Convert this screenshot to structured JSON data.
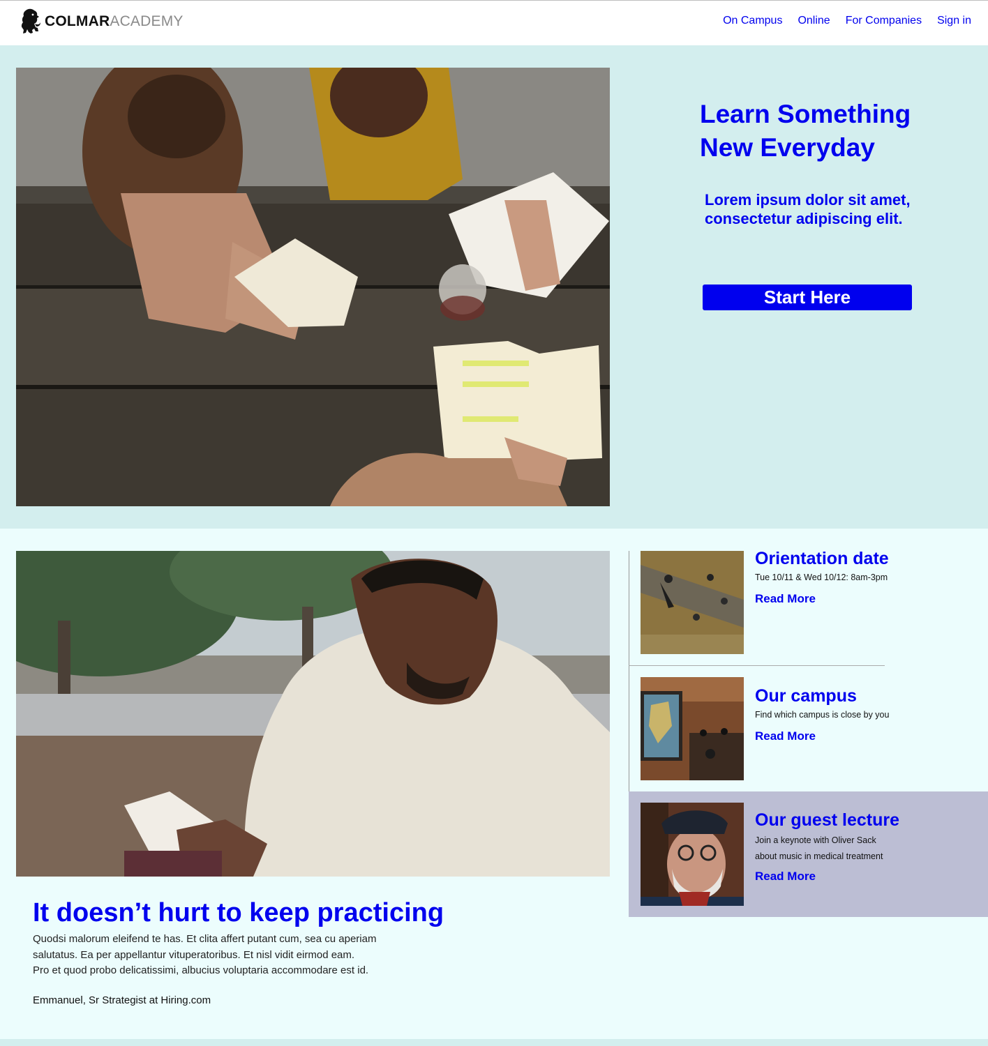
{
  "header": {
    "logo_bold": "COLMAR",
    "logo_light": "ACADEMY",
    "nav": [
      "On Campus",
      "Online",
      "For Companies",
      "Sign in"
    ]
  },
  "hero": {
    "title_line1": "Learn Something",
    "title_line2": "New Everyday",
    "subtitle": "Lorem ipsum dolor sit amet, consectetur adipiscing elit.",
    "button_label": "Start Here"
  },
  "feature": {
    "title": "It doesn’t hurt to keep practicing",
    "body_lines": [
      "Quodsi malorum eleifend te has. Et clita affert putant cum, sea cu aperiam",
      "salutatus. Ea per appellantur vituperatoribus. Et nisl vidit eirmod eam.",
      "Pro et quod probo delicatissimi, albucius voluptaria accommodare est id."
    ],
    "attribution": "Emmanuel, Sr Strategist at Hiring.com"
  },
  "cards": [
    {
      "title": "Orientation date",
      "desc_lines": [
        "Tue 10/11 & Wed 10/12: 8am-3pm"
      ],
      "link": "Read More"
    },
    {
      "title": "Our campus",
      "desc_lines": [
        "Find which campus is close by you"
      ],
      "link": "Read More"
    },
    {
      "title": "Our guest lecture",
      "desc_lines": [
        "Join a keynote with Oliver Sack",
        "about music in medical treatment"
      ],
      "link": "Read More"
    }
  ],
  "colors": {
    "accent": "#0000ee",
    "hero_bg": "#d3eeee",
    "page_bg": "#ecfdfd",
    "highlight_card_bg": "#bcbed4"
  }
}
